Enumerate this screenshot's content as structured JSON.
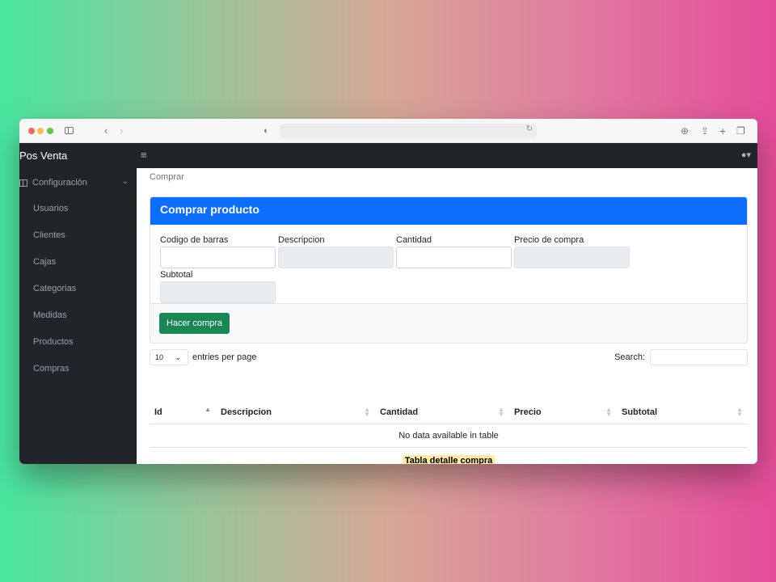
{
  "app": {
    "brand": "Pos Venta"
  },
  "sidebar": {
    "section": "Configuración",
    "items": [
      {
        "label": "Usuarios"
      },
      {
        "label": "Clientes"
      },
      {
        "label": "Cajas"
      },
      {
        "label": "Categorias"
      },
      {
        "label": "Medidas"
      },
      {
        "label": "Productos"
      },
      {
        "label": "Compras"
      }
    ]
  },
  "breadcrumb": "Comprar",
  "card": {
    "title": "Comprar producto",
    "fields": {
      "barcode": {
        "label": "Codigo de barras",
        "value": ""
      },
      "description": {
        "label": "Descripcion",
        "value": ""
      },
      "quantity": {
        "label": "Cantidad",
        "value": ""
      },
      "price": {
        "label": "Precio de compra",
        "value": ""
      },
      "subtotal": {
        "label": "Subtotal",
        "value": ""
      }
    },
    "submit_label": "Hacer compra"
  },
  "datatable": {
    "entries_value": "10",
    "entries_label": "entries per page",
    "search_label": "Search:",
    "columns": [
      "Id",
      "Descripcion",
      "Cantidad",
      "Precio",
      "Subtotal"
    ],
    "empty_message": "No data available in table",
    "caption": "Tabla detalle compra"
  },
  "colors": {
    "primary": "#0d6efd",
    "success": "#198754",
    "sidebar_bg": "#212529"
  }
}
